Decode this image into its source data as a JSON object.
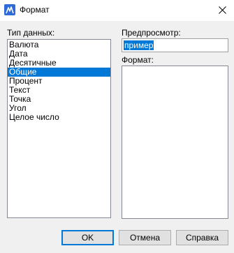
{
  "window": {
    "title": "Формат",
    "icon": "app-icon",
    "close_icon": "close-icon"
  },
  "data_types": {
    "label": "Тип данных:",
    "items": [
      {
        "label": "Валюта",
        "selected": false
      },
      {
        "label": "Дата",
        "selected": false
      },
      {
        "label": "Десятичные",
        "selected": false
      },
      {
        "label": "Общие",
        "selected": true
      },
      {
        "label": "Процент",
        "selected": false
      },
      {
        "label": "Текст",
        "selected": false
      },
      {
        "label": "Точка",
        "selected": false
      },
      {
        "label": "Угол",
        "selected": false
      },
      {
        "label": "Целое число",
        "selected": false
      }
    ]
  },
  "preview": {
    "label": "Предпросмотр:",
    "value": "пример"
  },
  "format": {
    "label": "Формат:",
    "value": ""
  },
  "buttons": {
    "ok": "OK",
    "cancel": "Отмена",
    "help": "Справка"
  },
  "colors": {
    "selection": "#0078d7",
    "window_bg": "#f0f0f0",
    "titlebar_bg": "#ffffff"
  }
}
